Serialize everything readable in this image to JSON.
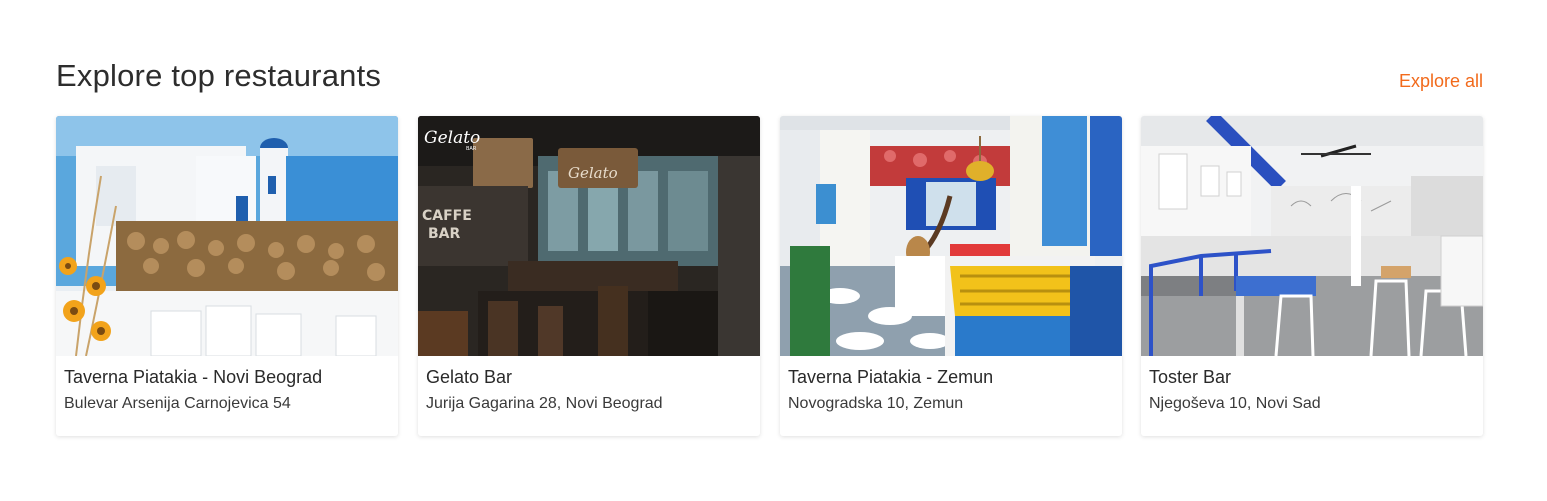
{
  "section": {
    "title": "Explore top restaurants",
    "explore_all_label": "Explore all"
  },
  "colors": {
    "accent": "#f26a1b",
    "text": "#2d2d2d"
  },
  "restaurants": [
    {
      "name": "Taverna Piatakia - Novi Beograd",
      "address": "Bulevar Arsenija Carnojevica 54",
      "image": "greek-mural-interior-photo"
    },
    {
      "name": "Gelato Bar",
      "address": "Jurija Gagarina 28, Novi Beograd",
      "image": "dark-bar-interior-photo",
      "image_text": [
        "Gelato",
        "BAR",
        "Gelato",
        "CAFFE",
        "BAR"
      ]
    },
    {
      "name": "Taverna Piatakia - Zemun",
      "address": "Novogradska 10, Zemun",
      "image": "colorful-taverna-interior-photo"
    },
    {
      "name": "Toster Bar",
      "address": "Njegoševa 10, Novi Sad",
      "image": "bright-cafe-interior-photo"
    }
  ]
}
